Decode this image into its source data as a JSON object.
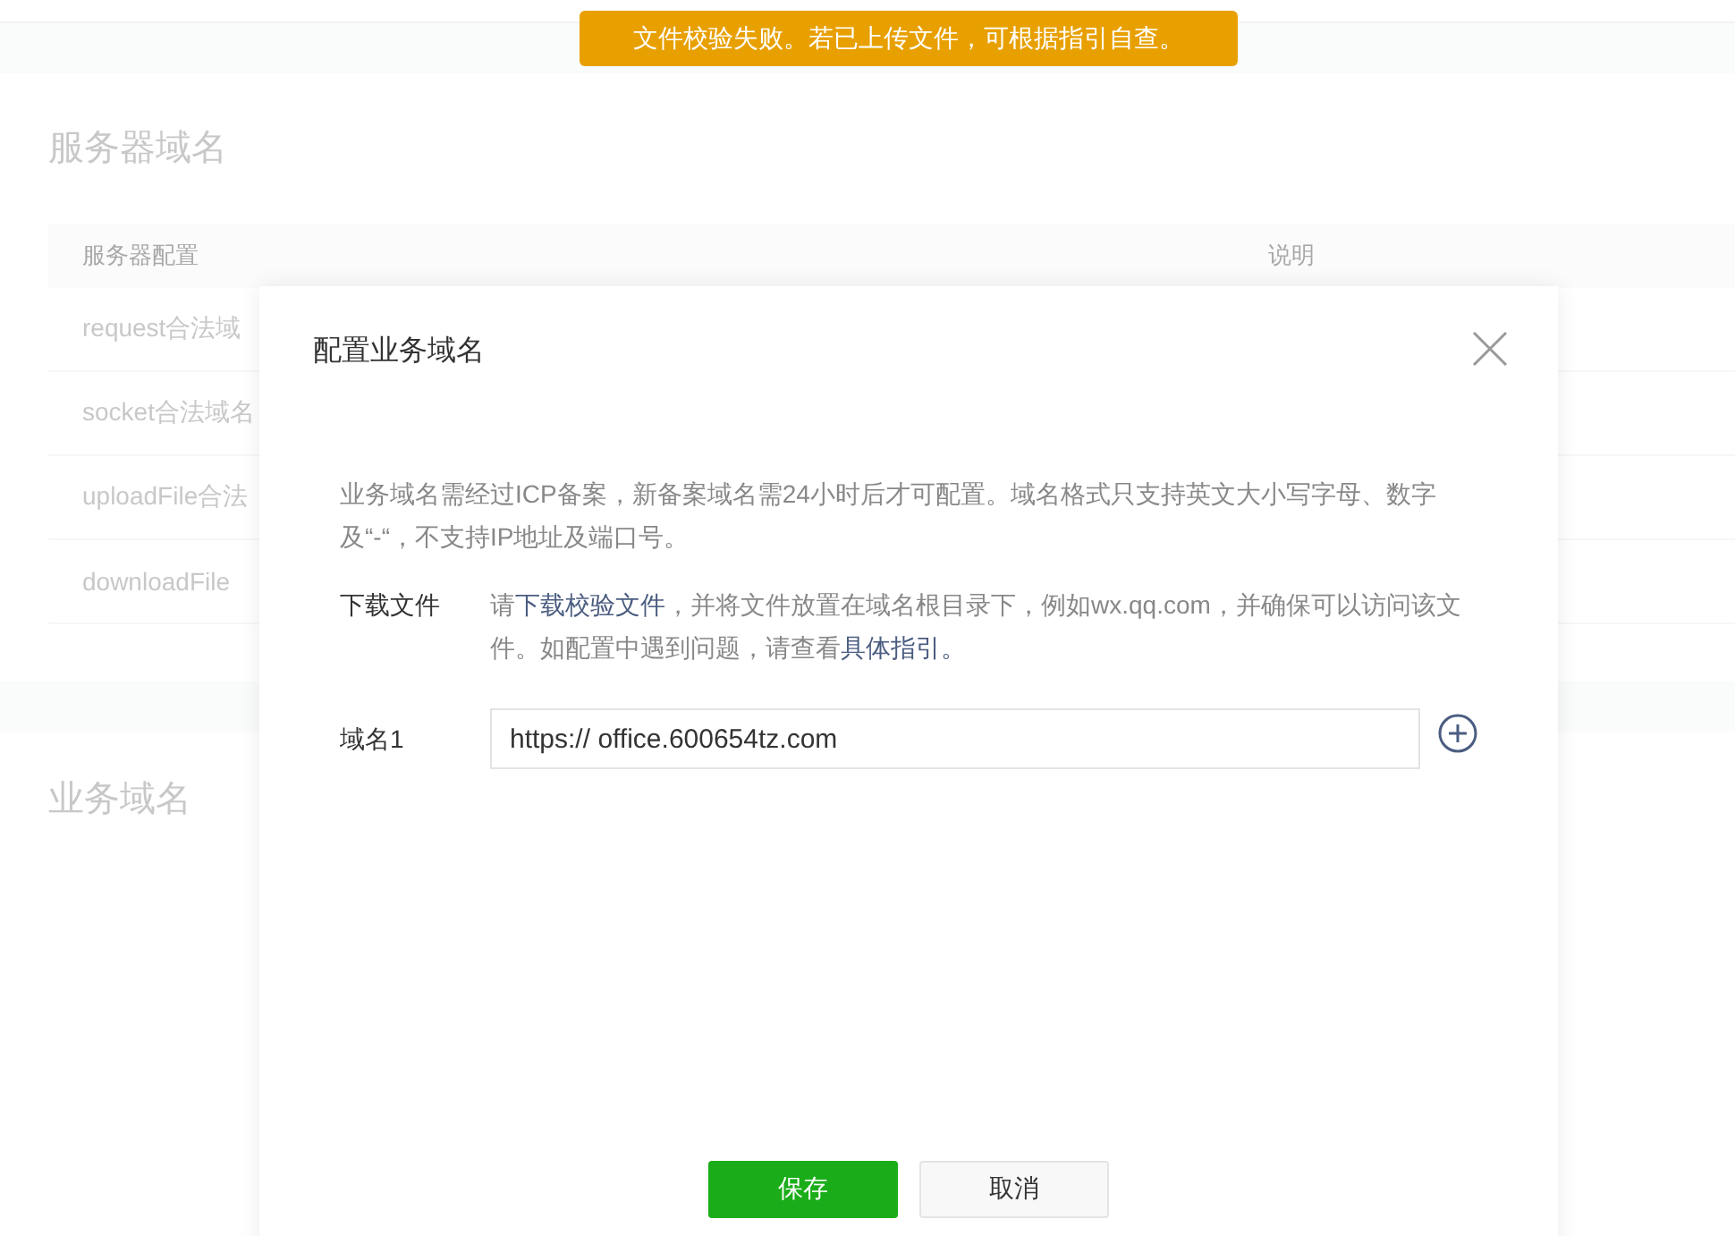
{
  "toast": {
    "text": "文件校验失败。若已上传文件，可根据指引自查。"
  },
  "page": {
    "server_section": {
      "title": "服务器域名",
      "columns": [
        "服务器配置",
        "说明"
      ],
      "rows": [
        "request合法域",
        "socket合法域名",
        "uploadFile合法",
        "downloadFile"
      ]
    },
    "business_section": {
      "title": "业务域名"
    }
  },
  "dialog": {
    "title": "配置业务域名",
    "notice": "业务域名需经过ICP备案，新备案域名需24小时后才可配置。域名格式只支持英文大小写字母、数字及“-“，不支持IP地址及端口号。",
    "download": {
      "label": "下载文件",
      "parts": [
        {
          "kind": "text",
          "text": "请"
        },
        {
          "kind": "link",
          "text": "下载校验文件"
        },
        {
          "kind": "text",
          "text": "，并将文件放置在域名根目录下，例如wx.qq.com，并确保可以访问该文件。如配置中遇到问题，请查看"
        },
        {
          "kind": "link",
          "text": "具体指引。"
        }
      ]
    },
    "domains": [
      {
        "label": "域名1",
        "value": "https:// office.600654tz.com"
      }
    ],
    "buttons": [
      {
        "kind": "primary",
        "label": "保存"
      },
      {
        "kind": "default",
        "label": "取消"
      }
    ]
  }
}
